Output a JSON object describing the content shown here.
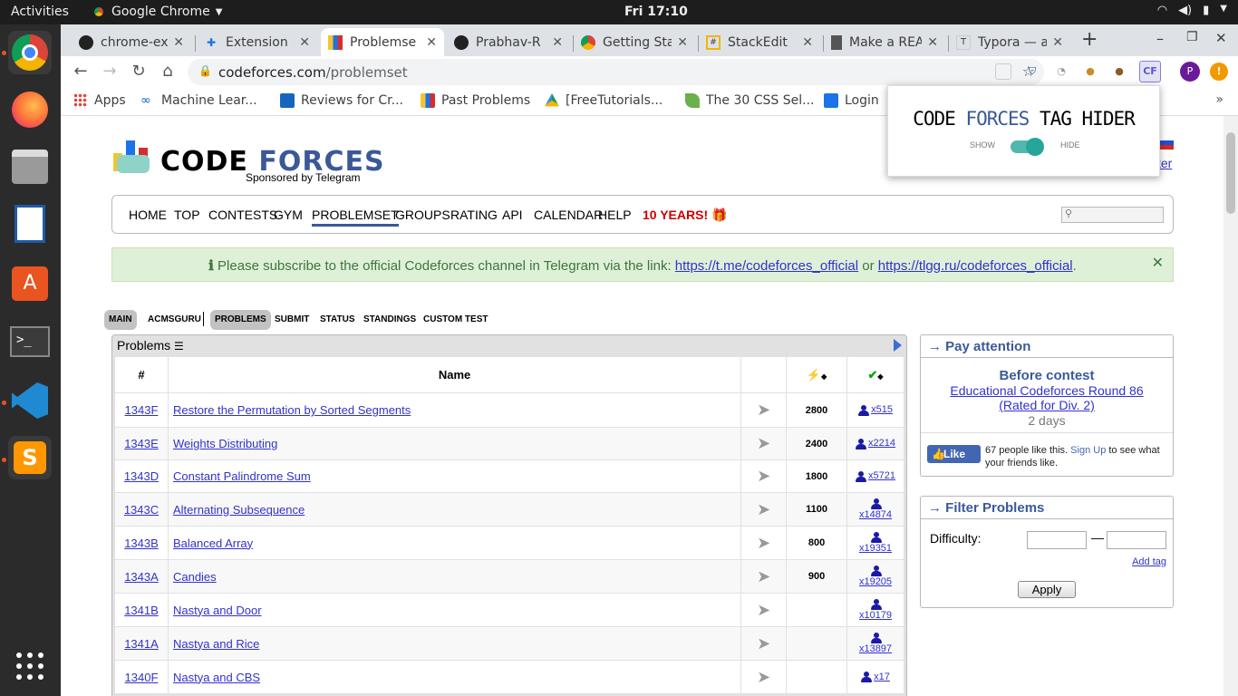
{
  "topbar": {
    "activities": "Activities",
    "app_name": "Google Chrome",
    "clock": "Fri 17:10"
  },
  "tabs": [
    {
      "title": "chrome-ext",
      "icon": "github-icon"
    },
    {
      "title": "Extension",
      "icon": "puzzle-icon"
    },
    {
      "title": "Problemse",
      "icon": "codeforces-icon"
    },
    {
      "title": "Prabhav-R",
      "icon": "github-icon"
    },
    {
      "title": "Getting Sta",
      "icon": "chrome-icon"
    },
    {
      "title": "StackEdit",
      "icon": "stackedit-icon"
    },
    {
      "title": "Make a REA",
      "icon": "doc-icon"
    },
    {
      "title": "Typora — a",
      "icon": "typora-icon"
    }
  ],
  "address": {
    "host": "codeforces.com",
    "path": "/problemset"
  },
  "bookmarks": [
    {
      "label": "Apps",
      "color": "#4285f4"
    },
    {
      "label": "Machine Lear...",
      "color": "#1565c0"
    },
    {
      "label": "Reviews for Cr...",
      "color": "#1565c0"
    },
    {
      "label": "Past Problems",
      "color": "#f4b400"
    },
    {
      "label": "[FreeTutorials...",
      "color": "#0f9d58"
    },
    {
      "label": "The 30 CSS Sel...",
      "color": "#6ab04c"
    },
    {
      "label": "Login",
      "color": "#1a73e8"
    }
  ],
  "extension_popup": {
    "title_a": "CODE ",
    "title_b": "FORCES",
    "title_c": " TAG HIDER",
    "show_label": "SHOW",
    "hide_label": "HIDE"
  },
  "site": {
    "logo_code": "CODE",
    "logo_forces": "FORCES",
    "sponsor": "Sponsored by Telegram",
    "enter_partial": "ter",
    "menu": [
      "HOME",
      "TOP",
      "CONTESTS",
      "GYM",
      "PROBLEMSET",
      "GROUPS",
      "RATING",
      "API",
      "CALENDAR",
      "HELP",
      "10 YEARS!"
    ],
    "alert": {
      "text_before": "Please subscribe to the official Codeforces channel in Telegram via the link: ",
      "link1": "https://t.me/codeforces_official",
      "text_mid": " or ",
      "link2": "https://tlgg.ru/codeforces_official",
      "text_after": "."
    },
    "subnav": [
      "MAIN",
      "ACMSGURU",
      "PROBLEMS",
      "SUBMIT",
      "STATUS",
      "STANDINGS",
      "CUSTOM TEST"
    ]
  },
  "problems": {
    "caption": "Problems",
    "columns": {
      "id": "#",
      "name": "Name"
    },
    "rows": [
      {
        "id": "1343F",
        "name": "Restore the Permutation by Sorted Segments",
        "diff": "2800",
        "solved": "x515"
      },
      {
        "id": "1343E",
        "name": "Weights Distributing",
        "diff": "2400",
        "solved": "x2214"
      },
      {
        "id": "1343D",
        "name": "Constant Palindrome Sum",
        "diff": "1800",
        "solved": "x5721"
      },
      {
        "id": "1343C",
        "name": "Alternating Subsequence",
        "diff": "1100",
        "solved": "x14874"
      },
      {
        "id": "1343B",
        "name": "Balanced Array",
        "diff": "800",
        "solved": "x19351"
      },
      {
        "id": "1343A",
        "name": "Candies",
        "diff": "900",
        "solved": "x19205"
      },
      {
        "id": "1341B",
        "name": "Nastya and Door",
        "diff": "",
        "solved": "x10179"
      },
      {
        "id": "1341A",
        "name": "Nastya and Rice",
        "diff": "",
        "solved": "x13897"
      },
      {
        "id": "1340F",
        "name": "Nastya and CBS",
        "diff": "",
        "solved": "x17"
      }
    ]
  },
  "pay_attention": {
    "title": "Pay attention",
    "before": "Before contest",
    "contest": "Educational Codeforces Round 86 (Rated for Div. 2)",
    "days": "2 days",
    "fb_like": "Like",
    "fb_text": "67 people like this. ",
    "fb_signup": "Sign Up",
    "fb_rest": " to see what your friends like."
  },
  "filter": {
    "title": "Filter Problems",
    "difficulty": "Difficulty:",
    "dash": "—",
    "add_tag": "Add tag",
    "apply": "Apply"
  }
}
